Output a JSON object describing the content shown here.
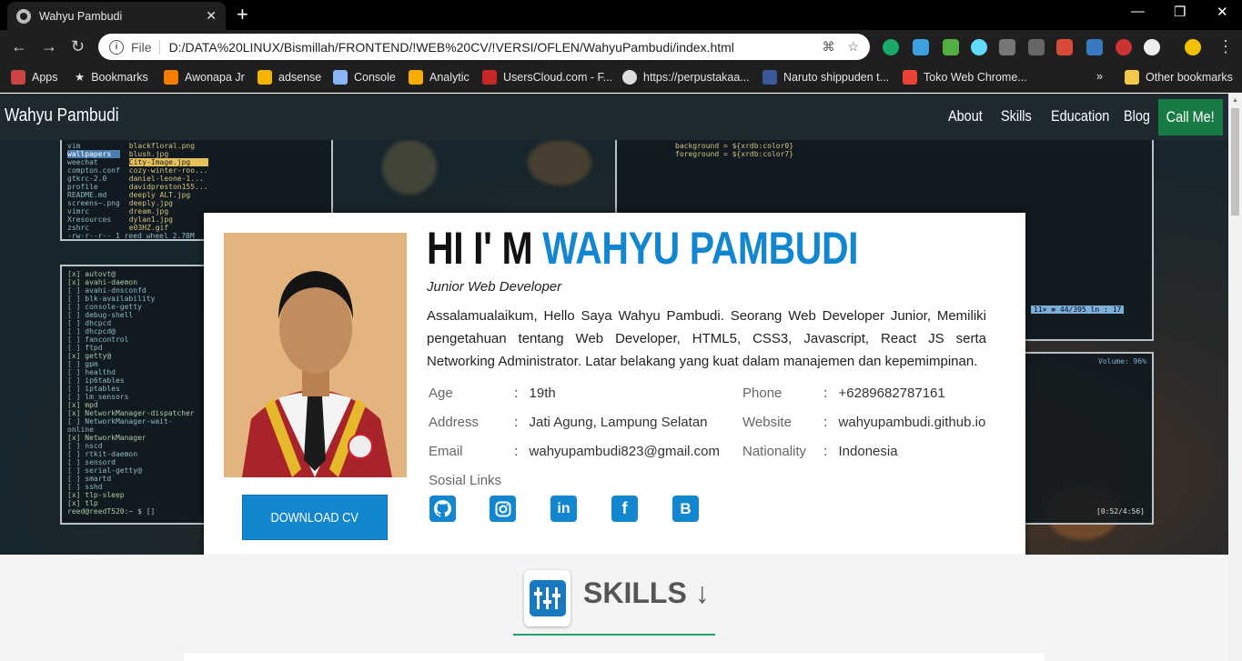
{
  "browser": {
    "tab_title": "Wahyu Pambudi",
    "url_scheme": "File",
    "url": "D:/DATA%20LINUX/Bismillah/FRONTEND/!WEB%20CV/!VERSI/OFLEN/WahyuPambudi/index.html",
    "bookmarks": [
      "Apps",
      "Bookmarks",
      "Awonapa Jr",
      "adsense",
      "Console",
      "Analytic",
      "UsersCloud.com - F...",
      "https://perpustakaa...",
      "Naruto shippuden t...",
      "Toko Web Chrome..."
    ],
    "more_bookmarks": "»",
    "other_bookmarks": "Other bookmarks"
  },
  "navbar": {
    "brand": "Wahyu Pambudi",
    "links": [
      "About",
      "Skills",
      "Education",
      "Blog"
    ],
    "cta": "Call Me!"
  },
  "profile": {
    "greeting": "HI I' M",
    "name": "WAHYU PAMBUDI",
    "role": "Junior Web Developer",
    "description": "Assalamualaikum, Hello Saya Wahyu Pambudi. Seorang Web Developer Junior, Memiliki pengetahuan tentang Web Developer, HTML5, CSS3, Javascript, React JS serta Networking Administrator. Latar belakang yang kuat dalam manajemen dan kepemimpinan.",
    "download_label": "DOWNLOAD CV",
    "details_left": [
      {
        "label": "Age",
        "value": "19th"
      },
      {
        "label": "Address",
        "value": "Jati Agung, Lampung Selatan"
      },
      {
        "label": "Email",
        "value": "wahyupambudi823@gmail.com"
      }
    ],
    "details_right": [
      {
        "label": "Phone",
        "value": "+6289682787161"
      },
      {
        "label": "Website",
        "value": "wahyupambudi.github.io"
      },
      {
        "label": "Nationality",
        "value": "Indonesia"
      }
    ],
    "separator": ":",
    "social_title": "Sosial Links",
    "social_icons": [
      "github-icon",
      "instagram-icon",
      "linkedin-icon",
      "facebook-icon",
      "blogger-icon"
    ],
    "accent_color": "#1287d0"
  },
  "skills": {
    "title": "SKILLS ↓"
  },
  "terminal_left_top": [
    "vim",
    "wallpapers",
    "weechat",
    "compton.conf",
    "gtkrc-2.0",
    "profile",
    "README.md",
    "screens~.png",
    "vimrc",
    "Xresources",
    "zshrc",
    "-rw-r--r-- 1 reed wheel 2.78M"
  ],
  "terminal_left_top_files": [
    "blackfloral.png",
    "blush.jpg",
    "City-Image.jpg",
    "cozy-winter-roo...",
    "daniel-leone-1...",
    "davidpreston155...",
    "deeply ALT.jpg",
    "deeply.jpg",
    "dream.jpg",
    "dylan1.jpg",
    "e03HZ.gif"
  ],
  "terminal_left_bottom": [
    "[x] autovt@",
    "[x] avahi-daemon",
    "[ ] avahi-dnsconfd",
    "[ ] blk-availability",
    "[ ] console-getty",
    "[ ] debug-shell",
    "[ ] dhcpcd",
    "[ ] dhcpcd@",
    "[ ] fancontrol",
    "[ ] ftpd",
    "[x] getty@",
    "[ ] gpm",
    "[ ] healthd",
    "[ ] ip6tables",
    "[ ] iptables",
    "[ ] lm_sensors",
    "[x] mpd",
    "[x] NetworkManager-dispatcher",
    "[ ] NetworkManager-wait-online",
    "[x] NetworkManager",
    "[ ] nscd",
    "[ ] rtkit-daemon",
    "[ ] sensord",
    "[ ] serial-getty@",
    "[ ] smartd",
    "[ ] sshd",
    "[x] tlp-sleep",
    "[x] tlp",
    "reed@reedT520:~ $ []"
  ],
  "terminal_right_top": [
    "background = ${xrdb:color0}",
    "foreground = ${xrdb:color7}"
  ],
  "terminal_right_status": "11× ≡   44/395 ln : 17",
  "terminal_right_bottom_vol": "Volume: 96%",
  "terminal_right_bottom_time": "[0:52/4:56]"
}
